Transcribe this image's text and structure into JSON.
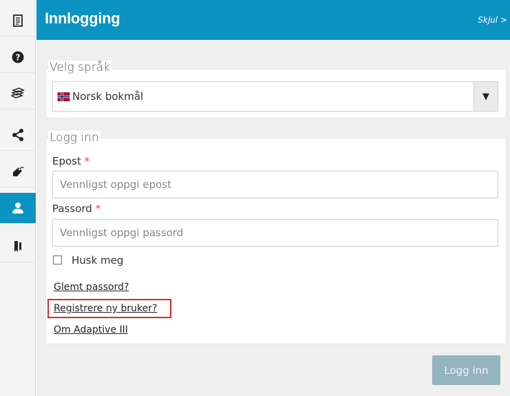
{
  "header": {
    "title": "Innlogging",
    "hide_label": "Skjul >"
  },
  "sidebar": {
    "items": [
      {
        "icon": "document-icon",
        "active": false
      },
      {
        "icon": "help-icon",
        "active": false
      },
      {
        "icon": "layers-icon",
        "active": false
      },
      {
        "icon": "share-icon",
        "active": false
      },
      {
        "icon": "tag-icon",
        "active": false
      },
      {
        "icon": "user-icon",
        "active": true
      },
      {
        "icon": "bookmark-icon",
        "active": false
      }
    ]
  },
  "language": {
    "legend": "Velg språk",
    "selected": "Norsk bokmål",
    "arrow": "▼"
  },
  "login": {
    "legend": "Logg inn",
    "email_label": "Epost",
    "email_placeholder": "Vennligst oppgi epost",
    "password_label": "Passord",
    "password_placeholder": "Vennligst oppgi passord",
    "required_mark": "*",
    "remember_label": "Husk meg",
    "links": {
      "forgot": "Glemt passord?",
      "register": "Registrere ny bruker?",
      "about": "Om Adaptive III"
    },
    "submit_label": "Logg inn"
  },
  "colors": {
    "accent": "#0b93c1",
    "highlight": "#d42a2a",
    "button_disabled": "#94b4c0"
  }
}
